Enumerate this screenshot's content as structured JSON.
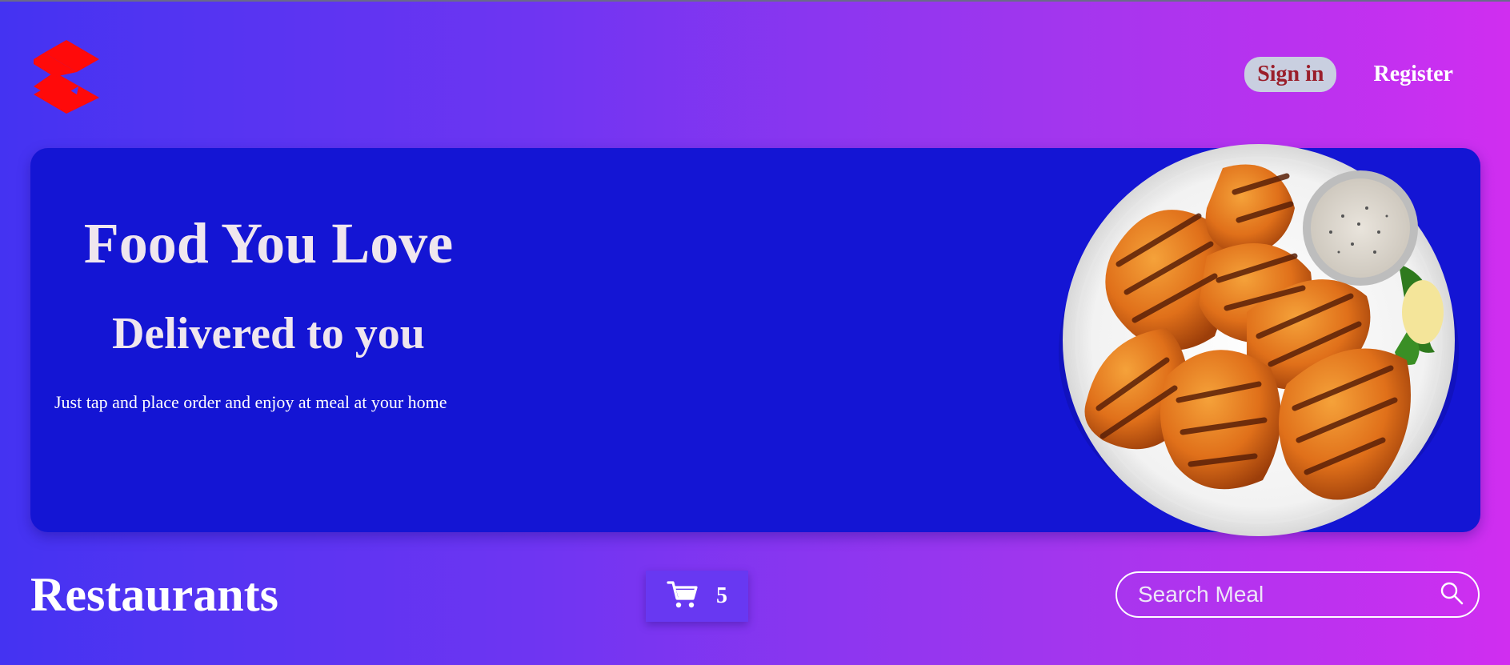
{
  "header": {
    "sign_in_label": "Sign in",
    "register_label": "Register",
    "logo_icon": "suzuki-style-s-logo",
    "logo_color": "#ff0a0a"
  },
  "hero": {
    "title": "Food You Love",
    "subtitle": "Delivered to you",
    "text": "Just tap and place order and enjoy at meal at your home",
    "image_icon": "grilled-chicken-plate-image",
    "background_color": "#1415d4"
  },
  "restaurants": {
    "title": "Restaurants",
    "cart_icon": "cart-icon",
    "cart_count": "5",
    "search_placeholder": "Search Meal",
    "search_icon": "search-icon"
  },
  "colors": {
    "gradient_start": "#4433f2",
    "gradient_end": "#d02ef0",
    "accent_text": "#9a1e2a"
  }
}
